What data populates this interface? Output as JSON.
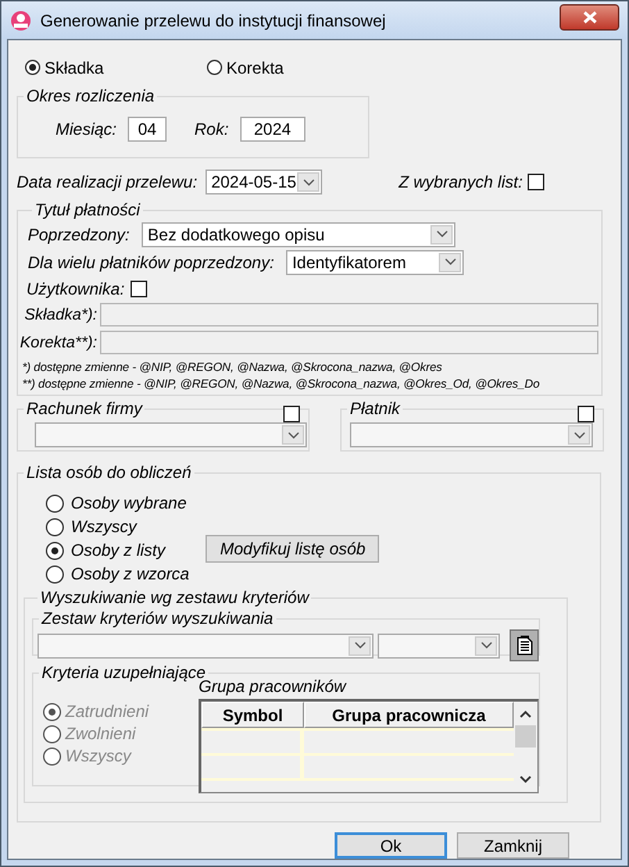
{
  "window": {
    "title": "Generowanie przelewu do instytucji finansowej"
  },
  "type_options": [
    {
      "label": "Składka",
      "selected": true
    },
    {
      "label": "Korekta",
      "selected": false
    }
  ],
  "period": {
    "title": "Okres rozliczenia",
    "month_label": "Miesiąc:",
    "month": "04",
    "year_label": "Rok:",
    "year": "2024"
  },
  "transfer_date": {
    "label": "Data realizacji przelewu:",
    "value": "2024-05-15"
  },
  "from_lists": {
    "label": "Z wybranych list:",
    "checked": false
  },
  "payment_title": {
    "title": "Tytuł płatności",
    "preceded_label": "Poprzedzony:",
    "preceded": "Bez dodatkowego opisu",
    "multi_label": "Dla wielu płatników poprzedzony:",
    "multi": "Identyfikatorem",
    "user": {
      "label": "Użytkownika:",
      "checked": false
    },
    "fields": [
      {
        "label": "Składka*):",
        "disabled": true
      },
      {
        "label": "Korekta**):",
        "disabled": true
      }
    ],
    "notes": [
      "*) dostępne zmienne - @NIP, @REGON, @Nazwa, @Skrocona_nazwa, @Okres",
      "**) dostępne zmienne - @NIP, @REGON, @Nazwa, @Skrocona_nazwa, @Okres_Od, @Okres_Do"
    ]
  },
  "company_account": {
    "title": "Rachunek firmy",
    "checked": false
  },
  "payer": {
    "title": "Płatnik",
    "checked": false
  },
  "people_list": {
    "title": "Lista osób do obliczeń",
    "modify_button": "Modyfikuj listę osób",
    "options": [
      {
        "label": "Osoby wybrane",
        "selected": false
      },
      {
        "label": "Wszyscy",
        "selected": false
      },
      {
        "label": "Osoby z listy",
        "selected": true
      },
      {
        "label": "Osoby z wzorca",
        "selected": false
      }
    ]
  },
  "search": {
    "title": "Wyszukiwanie wg zestawu kryteriów",
    "set_title": "Zestaw kryteriów wyszukiwania"
  },
  "supplementary": {
    "title": "Kryteria uzupełniające",
    "disabled": true,
    "options": [
      {
        "label": "Zatrudnieni",
        "selected": true
      },
      {
        "label": "Zwolnieni",
        "selected": false
      },
      {
        "label": "Wszyscy",
        "selected": false
      }
    ],
    "group_title": "Grupa pracowników",
    "columns": [
      "Symbol",
      "Grupa pracownicza"
    ]
  },
  "buttons": [
    {
      "label": "Ok",
      "default": true
    },
    {
      "label": "Zamknij",
      "default": false
    }
  ]
}
